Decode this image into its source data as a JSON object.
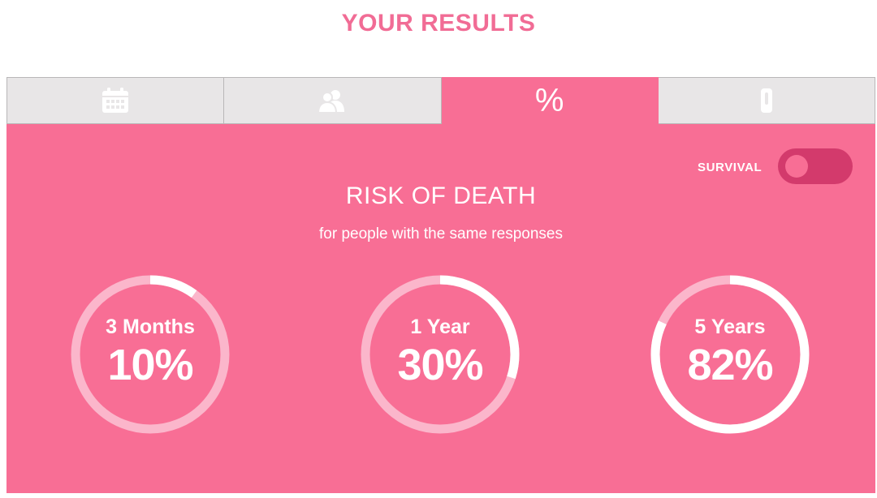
{
  "title": "YOUR RESULTS",
  "tabs": [
    {
      "icon": "calendar-icon",
      "active": false
    },
    {
      "icon": "people-icon",
      "active": false
    },
    {
      "icon": "percent-icon",
      "glyph": "%",
      "active": true
    },
    {
      "icon": "thermometer-icon",
      "active": false
    }
  ],
  "toggle": {
    "label": "SURVIVAL",
    "on": false
  },
  "heading": "RISK OF DEATH",
  "subheading": "for people with the same responses",
  "rings": [
    {
      "label": "3 Months",
      "value": "10%",
      "fraction": 0.1
    },
    {
      "label": "1 Year",
      "value": "30%",
      "fraction": 0.3
    },
    {
      "label": "5 Years",
      "value": "82%",
      "fraction": 0.82
    }
  ],
  "colors": {
    "accent": "#f16c95",
    "panel": "#f86e95",
    "toggle_track": "#d33a6c",
    "ring_track": "#fbb6cb",
    "ring_progress": "#ffffff",
    "tab_inactive": "#e8e6e7"
  }
}
